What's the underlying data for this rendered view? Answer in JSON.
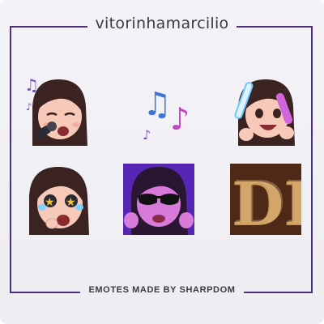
{
  "header": {
    "title": "vitorinhamarcilio"
  },
  "footer": {
    "text": "EMOTES MADE BY SHARPDOM"
  },
  "emotes": [
    {
      "name": "singing"
    },
    {
      "name": "music-notes"
    },
    {
      "name": "glowstick"
    },
    {
      "name": "starry-eyes"
    },
    {
      "name": "sunglasses"
    },
    {
      "name": "letter-d"
    }
  ],
  "colors": {
    "frame": "#4b2f7a",
    "hair": "#3a2320",
    "skin": "#f6c9b8",
    "purple": "#7b4ad0",
    "gold": "#b8864a"
  }
}
